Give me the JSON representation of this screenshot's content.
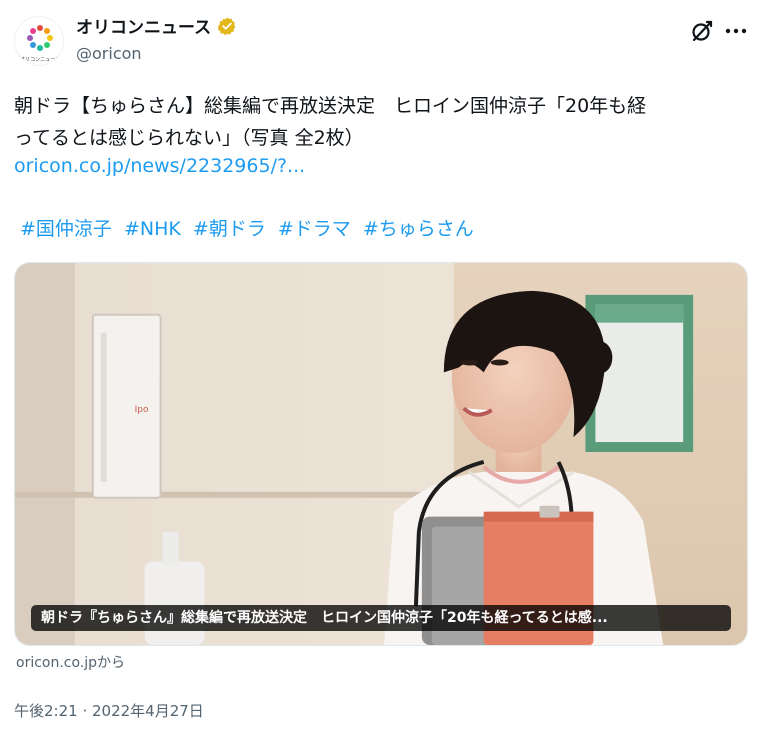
{
  "account": {
    "display_name": "オリコンニュース",
    "handle": "@oricon",
    "avatar_text": "オリコンニュース",
    "verified_color": "#e2b719"
  },
  "header": {
    "grok_icon": "grok-icon",
    "more_icon": "more-icon"
  },
  "tweet": {
    "text_line1": "朝ドラ【ちゅらさん】総集編で再放送決定　ヒロイン国仲涼子「20年も経",
    "text_line2": "ってるとは感じられない」（写真 全2枚）",
    "link": "oricon.co.jp/news/2232965/?...",
    "hashtags": [
      "#国仲涼子",
      "#NHK",
      "#朝ドラ",
      "#ドラマ",
      "#ちゅらさん"
    ]
  },
  "card": {
    "image_description_icon": "photo-nurse",
    "caption": "朝ドラ『ちゅらさん』総集編で再放送決定　ヒロイン国仲涼子「20年も経ってるとは感...",
    "source": "oricon.co.jpから",
    "wall_sign": "Ipo"
  },
  "meta": {
    "timestamp": "午後2:21 · 2022年4月27日"
  },
  "colors": {
    "link": "#1d9bf0",
    "text": "#0f1419",
    "secondary": "#536471"
  }
}
